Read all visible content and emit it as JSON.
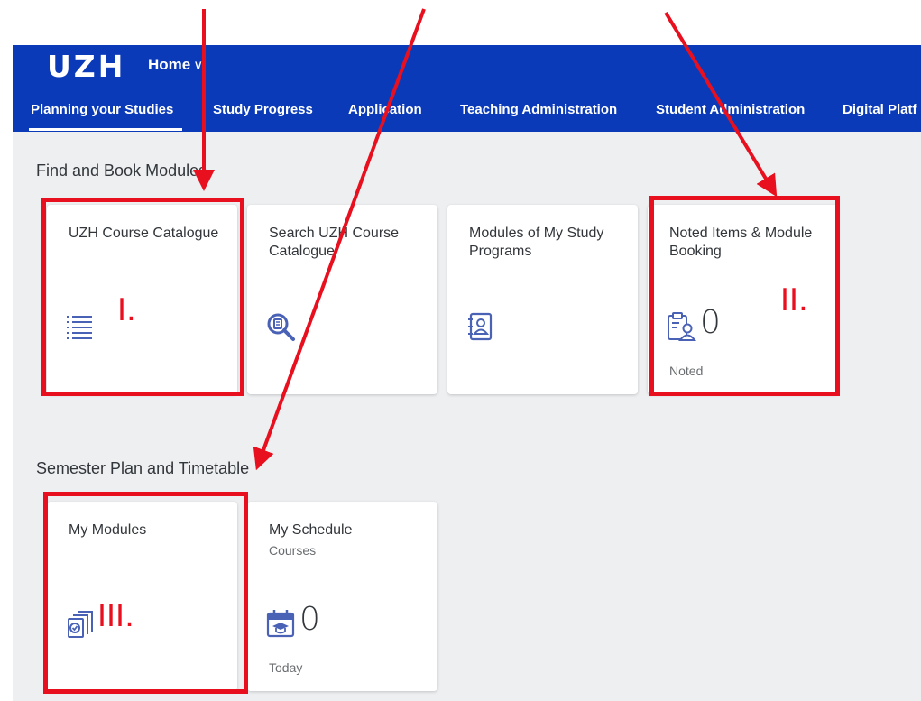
{
  "header": {
    "logo": "UZH",
    "home_label": "Home",
    "home_chevron": "∨"
  },
  "tabs": [
    {
      "label": "Planning your Studies",
      "selected": true
    },
    {
      "label": "Study Progress"
    },
    {
      "label": "Application"
    },
    {
      "label": "Teaching Administration"
    },
    {
      "label": "Student Administration"
    },
    {
      "label": "Digital Platf"
    }
  ],
  "groups": [
    {
      "title": "Find and Book Modules",
      "tiles": [
        {
          "title": "UZH Course Catalogue",
          "icon": "list-icon"
        },
        {
          "title": "Search UZH Course Catalogue",
          "icon": "search-catalogue-icon"
        },
        {
          "title": "Modules of My Study Programs",
          "icon": "address-book-icon"
        },
        {
          "title": "Noted Items & Module Booking",
          "icon": "clipboard-person-icon",
          "number": "0",
          "footer": "Noted"
        }
      ]
    },
    {
      "title": "Semester Plan and Timetable",
      "tiles": [
        {
          "title": "My Modules",
          "icon": "stacked-documents-icon"
        },
        {
          "title": "My Schedule",
          "subtitle": "Courses",
          "icon": "calendar-education-icon",
          "number": "0",
          "footer": "Today"
        }
      ]
    }
  ],
  "annotations": {
    "labels": [
      "I.",
      "II.",
      "III."
    ],
    "color": "#e8101f"
  },
  "colors": {
    "shell_blue": "#0a3ab8",
    "icon_blue": "#4a62b5",
    "content_bg": "#edeff1"
  }
}
